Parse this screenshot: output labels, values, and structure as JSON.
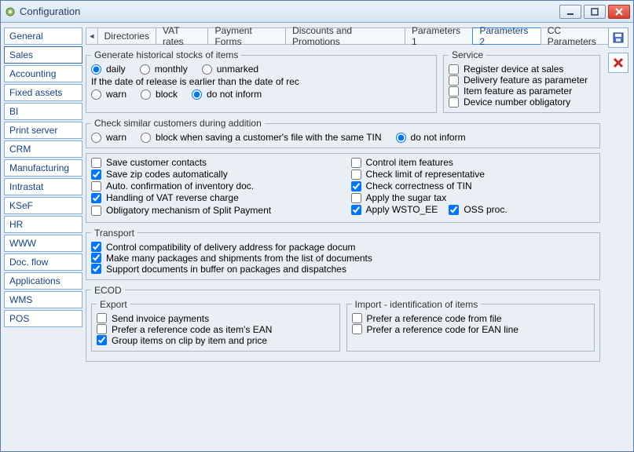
{
  "window": {
    "title": "Configuration"
  },
  "sidebar": {
    "items": [
      {
        "label": "General"
      },
      {
        "label": "Sales"
      },
      {
        "label": "Accounting"
      },
      {
        "label": "Fixed assets"
      },
      {
        "label": "BI"
      },
      {
        "label": "Print server"
      },
      {
        "label": "CRM"
      },
      {
        "label": "Manufacturing"
      },
      {
        "label": "Intrastat"
      },
      {
        "label": "KSeF"
      },
      {
        "label": "HR"
      },
      {
        "label": "WWW"
      },
      {
        "label": "Doc. flow"
      },
      {
        "label": "Applications"
      },
      {
        "label": "WMS"
      },
      {
        "label": "POS"
      }
    ],
    "active_index": 1
  },
  "tabs": {
    "items": [
      {
        "label": "Directories"
      },
      {
        "label": "VAT rates"
      },
      {
        "label": "Payment Forms"
      },
      {
        "label": "Discounts and Promotions"
      },
      {
        "label": "Parameters 1"
      },
      {
        "label": "Parameters 2"
      },
      {
        "label": "CC Parameters"
      }
    ],
    "active_index": 5
  },
  "historical": {
    "legend": "Generate historical stocks of items",
    "options": {
      "daily": "daily",
      "monthly": "monthly",
      "unmarked": "unmarked"
    },
    "selected": "daily"
  },
  "release": {
    "legend": "If the date of release is earlier than the date of rec",
    "options": {
      "warn": "warn",
      "block": "block",
      "do_not_inform": "do not inform"
    },
    "selected": "do_not_inform"
  },
  "service": {
    "legend": "Service",
    "items": [
      {
        "label": "Register device at sales",
        "checked": false
      },
      {
        "label": "Delivery feature as parameter",
        "checked": false
      },
      {
        "label": "Item feature as parameter",
        "checked": false
      },
      {
        "label": "Device number obligatory",
        "checked": false
      }
    ]
  },
  "similar": {
    "legend": "Check similar customers during addition",
    "options": {
      "warn": "warn",
      "block": "block when saving a customer's file with the same TIN",
      "do_not_inform": "do not inform"
    },
    "selected": "do_not_inform"
  },
  "checks_left": [
    {
      "label": "Save customer contacts",
      "checked": false
    },
    {
      "label": "Save zip codes automatically",
      "checked": true
    },
    {
      "label": "Auto. confirmation of inventory doc.",
      "checked": false
    },
    {
      "label": "Handling of VAT reverse charge",
      "checked": true
    },
    {
      "label": "Obligatory mechanism of Split Payment",
      "checked": false
    }
  ],
  "checks_right": [
    {
      "label": "Control item features",
      "checked": false
    },
    {
      "label": "Check limit of representative",
      "checked": false
    },
    {
      "label": "Check correctness of TIN",
      "checked": true
    },
    {
      "label": "Apply the sugar tax",
      "checked": false
    }
  ],
  "checks_right_last": {
    "a": {
      "label": "Apply WSTO_EE",
      "checked": true
    },
    "b": {
      "label": "OSS proc.",
      "checked": true
    }
  },
  "transport": {
    "legend": "Transport",
    "items": [
      {
        "label": "Control compatibility of delivery address for package docum",
        "checked": true
      },
      {
        "label": "Make many packages and shipments from the list of documents",
        "checked": true
      },
      {
        "label": "Support documents in buffer on packages and dispatches",
        "checked": true
      }
    ]
  },
  "ecod": {
    "legend": "ECOD",
    "export": {
      "legend": "Export",
      "items": [
        {
          "label": "Send invoice payments",
          "checked": false
        },
        {
          "label": "Prefer a reference code as item's EAN",
          "checked": false
        },
        {
          "label": "Group items on clip by item and price",
          "checked": true
        }
      ]
    },
    "import": {
      "legend": "Import - identification of items",
      "items": [
        {
          "label": "Prefer a reference code from file",
          "checked": false
        },
        {
          "label": "Prefer a reference code for EAN line",
          "checked": false
        }
      ]
    }
  }
}
